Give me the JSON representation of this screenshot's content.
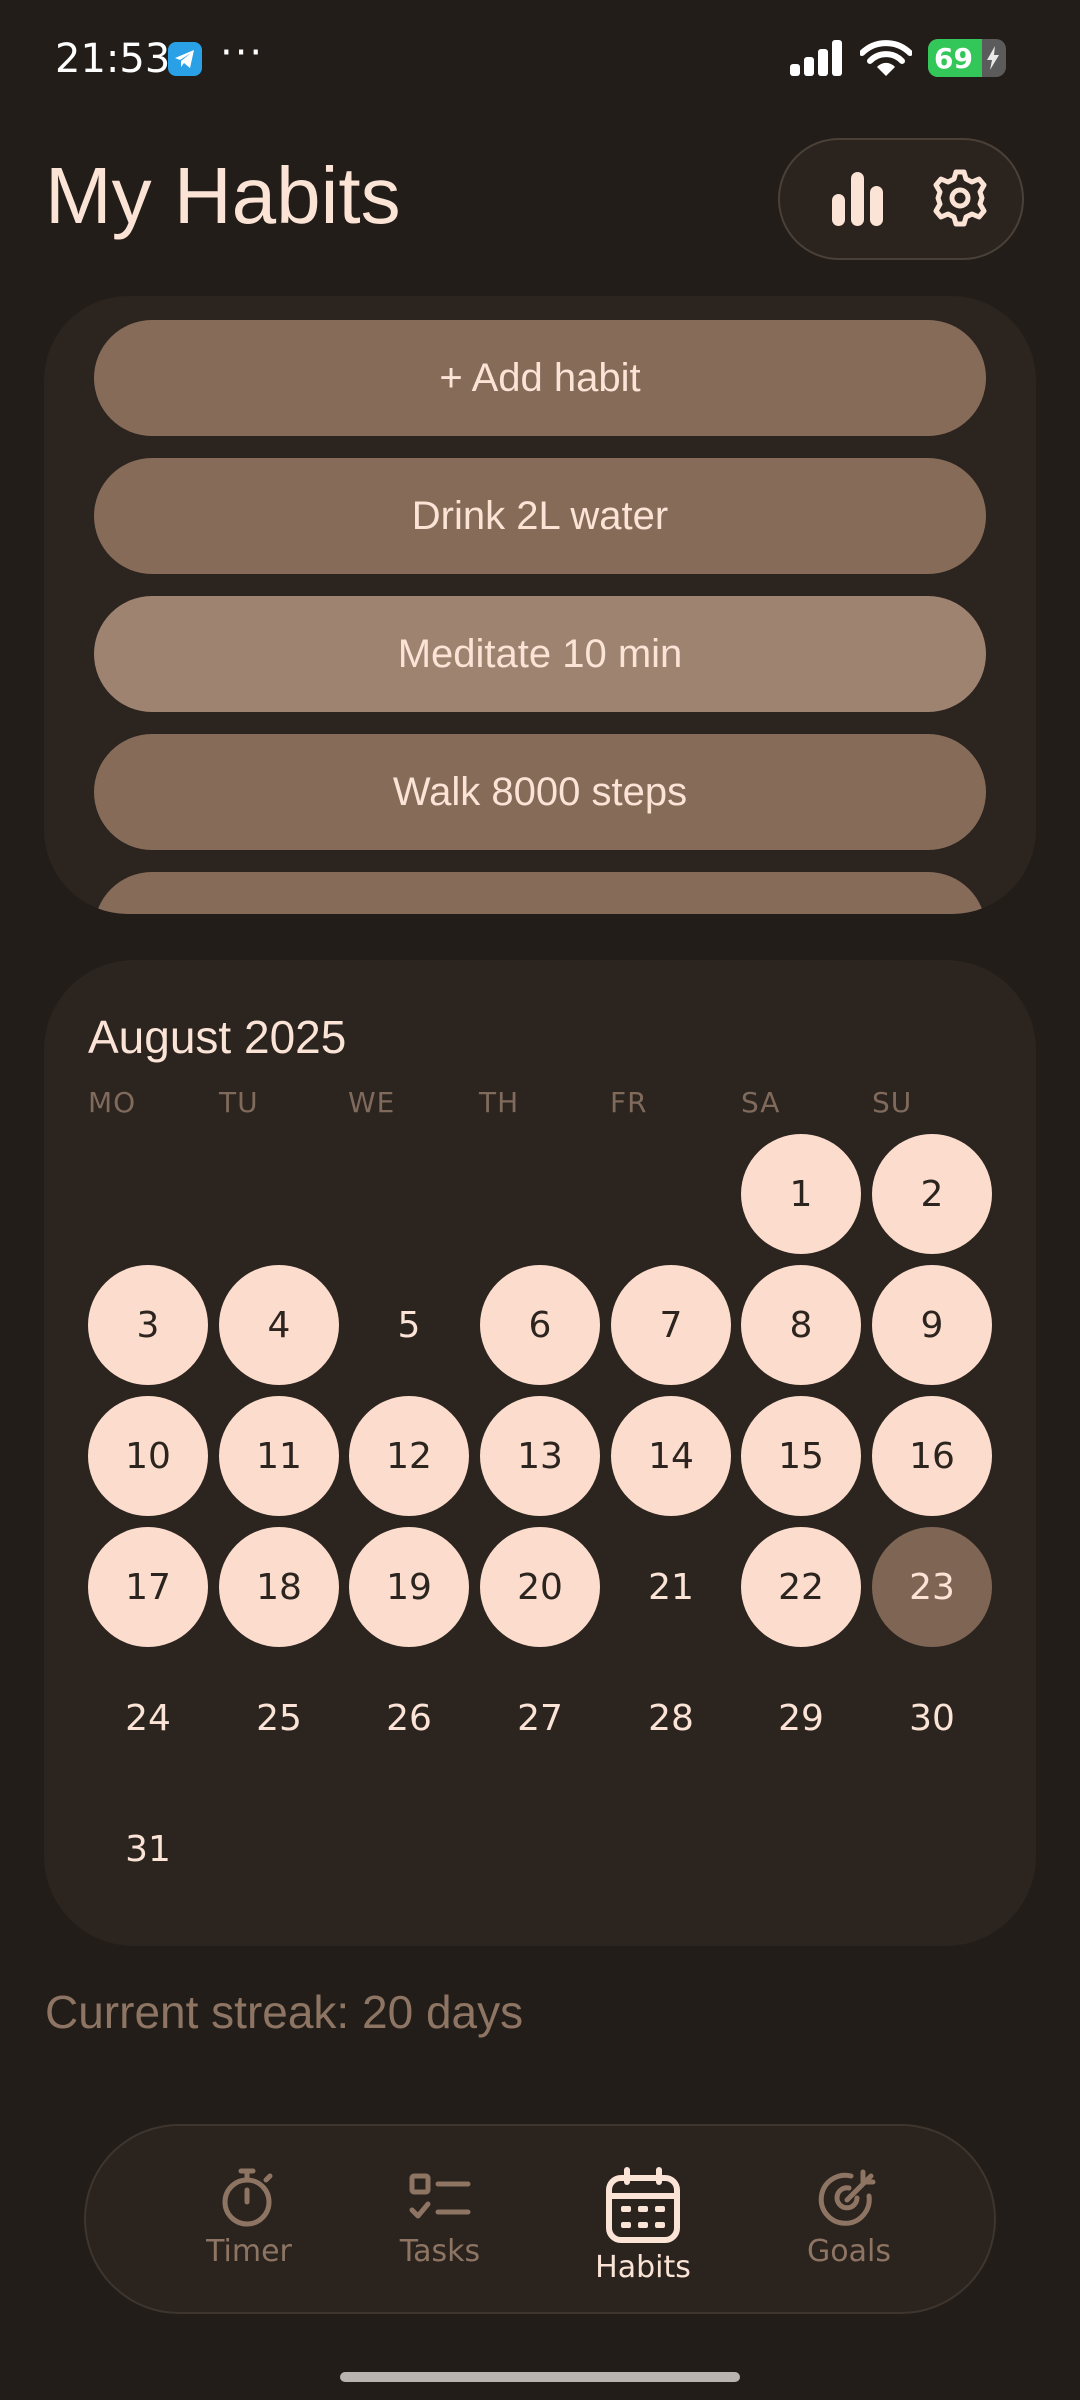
{
  "status_bar": {
    "time": "21:53",
    "app_icon": "telegram-icon",
    "more": "···",
    "battery_level": "69",
    "battery_fraction": 0.69,
    "charging": true
  },
  "header": {
    "title": "My Habits",
    "stats_icon": "bar-chart-icon",
    "settings_icon": "gear-icon"
  },
  "habits": {
    "add_label": "+ Add habit",
    "items": [
      {
        "label": "Drink 2L water",
        "active": false
      },
      {
        "label": "Meditate 10 min",
        "active": true
      },
      {
        "label": "Walk 8000 steps",
        "active": false
      }
    ]
  },
  "calendar": {
    "month_label": "August 2025",
    "weekdays": [
      "MO",
      "TU",
      "WE",
      "TH",
      "FR",
      "SA",
      "SU"
    ],
    "start_weekday_index": 5,
    "days_in_month": 31,
    "completed_days": [
      1,
      2,
      3,
      4,
      6,
      7,
      8,
      9,
      10,
      11,
      12,
      13,
      14,
      15,
      16,
      17,
      18,
      19,
      20,
      22
    ],
    "today": 23
  },
  "streak_text": "Current streak: 20 days",
  "nav": {
    "items": [
      {
        "label": "Timer",
        "icon": "stopwatch-icon",
        "active": false
      },
      {
        "label": "Tasks",
        "icon": "checklist-icon",
        "active": false
      },
      {
        "label": "Habits",
        "icon": "calendar-icon",
        "active": true
      },
      {
        "label": "Goals",
        "icon": "target-icon",
        "active": false
      }
    ]
  },
  "colors": {
    "background": "#221d18",
    "card": "#2b241f",
    "habit_button": "#866b59",
    "done_day": "#fcdccc",
    "today_day": "#7f6554",
    "text": "#fbe3d6",
    "muted_text": "#8e7563"
  }
}
